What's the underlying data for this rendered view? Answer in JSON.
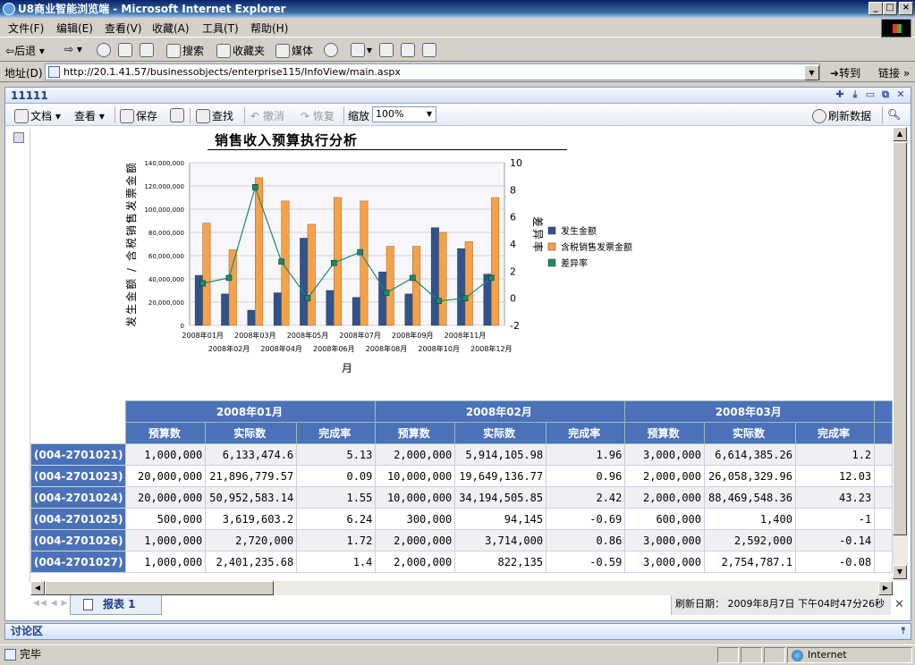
{
  "window": {
    "title": "U8商业智能浏览端 - Microsoft Internet Explorer"
  },
  "menu": [
    "文件(F)",
    "编辑(E)",
    "查看(V)",
    "收藏(A)",
    "工具(T)",
    "帮助(H)"
  ],
  "toolbar": {
    "back": "后退",
    "search": "搜索",
    "favorites": "收藏夹",
    "media": "媒体"
  },
  "address": {
    "label": "地址(D)",
    "url": "http://20.1.41.57/businessobjects/enterprise115/InfoView/main.aspx",
    "go": "转到",
    "links": "链接"
  },
  "panel": {
    "title": "11111"
  },
  "report_toolbar": {
    "document": "文档",
    "view": "查看",
    "save": "保存",
    "find": "查找",
    "undo": "撤消",
    "redo": "恢复",
    "zoom_label": "缩放",
    "zoom_value": "100%",
    "refresh": "刷新数据"
  },
  "report": {
    "title": "销售收入预算执行分析"
  },
  "chart_data": {
    "type": "bar",
    "categories": [
      "2008年01月",
      "2008年02月",
      "2008年03月",
      "2008年04月",
      "2008年05月",
      "2008年06月",
      "2008年07月",
      "2008年08月",
      "2008年09月",
      "2008年10月",
      "2008年11月",
      "2008年12月"
    ],
    "series": [
      {
        "name": "发生金额",
        "values": [
          43000000,
          27000000,
          13000000,
          28000000,
          75000000,
          30000000,
          24000000,
          46000000,
          27000000,
          84000000,
          66000000,
          44000000
        ],
        "color": "#31538c"
      },
      {
        "name": "含税销售发票金额",
        "values": [
          88000000,
          65000000,
          127000000,
          107000000,
          87000000,
          110000000,
          107000000,
          68000000,
          68000000,
          80000000,
          72000000,
          110000000
        ],
        "color": "#f4a24a"
      },
      {
        "name": "差异率",
        "values": [
          1.1,
          1.5,
          8.2,
          2.7,
          0,
          2.6,
          3.4,
          0.4,
          1.5,
          -0.2,
          0,
          1.5
        ],
        "color": "#1a8a6a",
        "axis": "right"
      }
    ],
    "xlabel": "月",
    "ylabel": "发生金额 / 含税销售发票金额",
    "y2label": "差异率",
    "ylim": [
      0,
      140000000
    ],
    "y2lim": [
      -2,
      10
    ],
    "yticks": [
      "0",
      "20,000,000",
      "40,000,000",
      "60,000,000",
      "80,000,000",
      "100,000,000",
      "120,000,000",
      "140,000,000"
    ],
    "y2ticks": [
      "-2",
      "0",
      "2",
      "4",
      "6",
      "8",
      "10"
    ],
    "legend": "right",
    "grid": true
  },
  "table": {
    "months": [
      "2008年01月",
      "2008年02月",
      "2008年03月"
    ],
    "subheaders": [
      "预算数",
      "实际数",
      "完成率"
    ],
    "rows": [
      {
        "id": "(004-2701021)",
        "cells": [
          "1,000,000",
          "6,133,474.6",
          "5.13",
          "2,000,000",
          "5,914,105.98",
          "1.96",
          "3,000,000",
          "6,614,385.26",
          "1.2"
        ]
      },
      {
        "id": "(004-2701023)",
        "cells": [
          "20,000,000",
          "21,896,779.57",
          "0.09",
          "10,000,000",
          "19,649,136.77",
          "0.96",
          "2,000,000",
          "26,058,329.96",
          "12.03"
        ]
      },
      {
        "id": "(004-2701024)",
        "cells": [
          "20,000,000",
          "50,952,583.14",
          "1.55",
          "10,000,000",
          "34,194,505.85",
          "2.42",
          "2,000,000",
          "88,469,548.36",
          "43.23"
        ]
      },
      {
        "id": "(004-2701025)",
        "cells": [
          "500,000",
          "3,619,603.2",
          "6.24",
          "300,000",
          "94,145",
          "-0.69",
          "600,000",
          "1,400",
          "-1"
        ]
      },
      {
        "id": "(004-2701026)",
        "cells": [
          "1,000,000",
          "2,720,000",
          "1.72",
          "2,000,000",
          "3,714,000",
          "0.86",
          "3,000,000",
          "2,592,000",
          "-0.14"
        ]
      },
      {
        "id": "(004-2701027)",
        "cells": [
          "1,000,000",
          "2,401,235.68",
          "1.4",
          "2,000,000",
          "822,135",
          "-0.59",
          "3,000,000",
          "2,754,787.1",
          "-0.08"
        ]
      }
    ]
  },
  "page_tab": "报表 1",
  "refresh_info": "刷新日期： 2009年8月7日 下午04时47分26秒",
  "discussion": "讨论区",
  "status": {
    "text": "完毕",
    "zone": "Internet"
  }
}
